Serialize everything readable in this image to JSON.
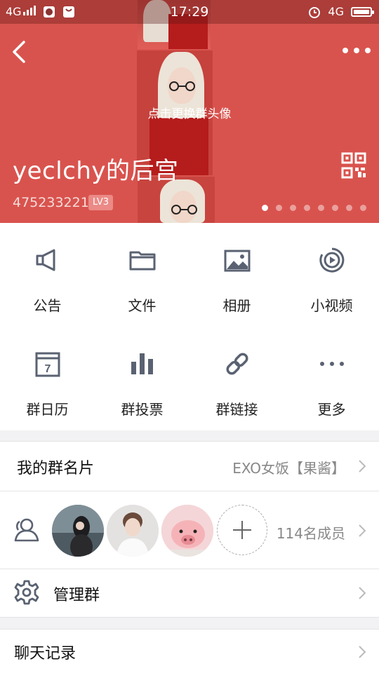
{
  "status_bar": {
    "network": "4G",
    "time": "17:29",
    "network_right": "4G"
  },
  "header": {
    "change_avatar_hint": "点击更换群头像",
    "group_name": "yeclchy的后宫",
    "group_id": "475233221",
    "level_badge": "LV3",
    "page_dots": 8,
    "active_dot": 0,
    "icons": {
      "back": "back-arrow-icon",
      "more": "more-dots-icon",
      "qr": "qr-code-icon"
    }
  },
  "functions": [
    {
      "label": "公告",
      "icon": "megaphone-icon"
    },
    {
      "label": "文件",
      "icon": "folder-icon"
    },
    {
      "label": "相册",
      "icon": "photo-album-icon"
    },
    {
      "label": "小视频",
      "icon": "video-play-icon"
    },
    {
      "label": "群日历",
      "icon": "calendar-icon"
    },
    {
      "label": "群投票",
      "icon": "vote-bars-icon"
    },
    {
      "label": "群链接",
      "icon": "link-icon"
    },
    {
      "label": "更多",
      "icon": "more-dots-icon"
    }
  ],
  "my_card": {
    "label": "我的群名片",
    "value": "EXO女饭【果酱】"
  },
  "members": {
    "count_label": "114名成员",
    "icon": "members-icon"
  },
  "manage": {
    "label": "管理群",
    "icon": "gear-icon"
  },
  "chat_history": {
    "label": "聊天记录"
  },
  "colors": {
    "hero_bg": "#d9534e",
    "icon_gray": "#5a6272",
    "text_secondary": "#888888"
  }
}
